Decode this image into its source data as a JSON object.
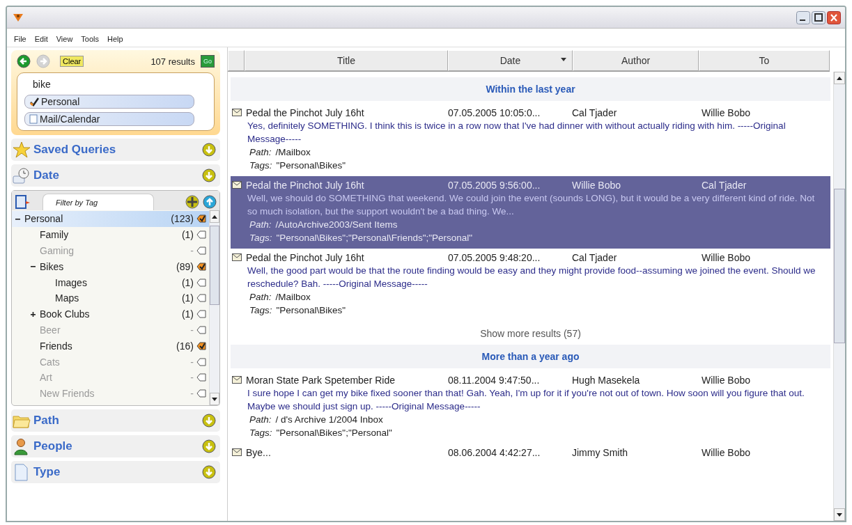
{
  "menu": [
    "File",
    "Edit",
    "View",
    "Tools",
    "Help"
  ],
  "search": {
    "back_disabled": false,
    "forward_disabled": true,
    "clear": "Clear",
    "results": "107 results",
    "go": "Go",
    "query": "bike",
    "scopes": [
      {
        "label": "Personal",
        "checked": true
      },
      {
        "label": "Mail/Calendar",
        "checked": false
      }
    ]
  },
  "sections_top": [
    {
      "label": "Saved Queries",
      "expanded": false
    },
    {
      "label": "Date",
      "expanded": false
    }
  ],
  "tag_panel": {
    "filter_placeholder": "Filter by Tag",
    "expanded": true,
    "tags": [
      {
        "name": "Personal",
        "count": "(123)",
        "checked": true,
        "disabled": false,
        "selected": true,
        "expanded": true,
        "children": [
          {
            "name": "Family",
            "count": "(1)",
            "checked": false,
            "disabled": false,
            "selected": false
          },
          {
            "name": "Gaming",
            "count": "-",
            "checked": false,
            "disabled": true,
            "selected": false
          },
          {
            "name": "Bikes",
            "count": "(89)",
            "checked": true,
            "disabled": false,
            "selected": false,
            "expanded": true,
            "children": [
              {
                "name": "Images",
                "count": "(1)",
                "checked": false,
                "disabled": false,
                "selected": false
              },
              {
                "name": "Maps",
                "count": "(1)",
                "checked": false,
                "disabled": false,
                "selected": false
              }
            ]
          },
          {
            "name": "Book Clubs",
            "count": "(1)",
            "checked": false,
            "disabled": false,
            "selected": false,
            "expanded": false
          },
          {
            "name": "Beer",
            "count": "-",
            "checked": false,
            "disabled": true,
            "selected": false
          },
          {
            "name": "Friends",
            "count": "(16)",
            "checked": true,
            "disabled": false,
            "selected": false
          },
          {
            "name": "Cats",
            "count": "-",
            "checked": false,
            "disabled": true,
            "selected": false
          },
          {
            "name": "Art",
            "count": "-",
            "checked": false,
            "disabled": true,
            "selected": false
          },
          {
            "name": "New Friends",
            "count": "-",
            "checked": false,
            "disabled": true,
            "selected": false
          }
        ]
      }
    ]
  },
  "sections_bottom": [
    {
      "label": "Path",
      "expanded": false
    },
    {
      "label": "People",
      "expanded": false
    },
    {
      "label": "Type",
      "expanded": false
    }
  ],
  "table": {
    "columns": [
      {
        "label": "Title",
        "sorted": false
      },
      {
        "label": "Date",
        "sorted": true
      },
      {
        "label": "Author",
        "sorted": false
      },
      {
        "label": "To",
        "sorted": false
      }
    ],
    "groups": [
      {
        "heading": "Within the last year",
        "more": "Show more results (57)",
        "rows": [
          {
            "title": "Pedal the Pinchot July 16ht",
            "date": "07.05.2005  10:05:0...",
            "author": "Cal Tjader",
            "to": "Willie Bobo",
            "selected": false,
            "body": "Yes, definitely SOMETHING.  I think this is twice in a row now that I've had dinner with            without actually riding with him.   -----Original  Message-----",
            "path_label": "Path:",
            "path": "/Mailbox",
            "tags_label": "Tags:",
            "tags": "\"Personal\\Bikes\""
          },
          {
            "title": "Pedal the Pinchot July 16ht",
            "date": "07.05.2005  9:56:00...",
            "author": "Willie Bobo",
            "to": "Cal Tjader",
            "selected": true,
            "body": "Well, we should do SOMETHING that weekend. We could join the event (sounds LONG), but it would be a very different kind of ride. Not so much isolation, but the support wouldn't be a bad thing.  We...",
            "path_label": "Path:",
            "path": "/AutoArchive2003/Sent Items",
            "tags_label": "Tags:",
            "tags": "\"Personal\\Bikes\";\"Personal\\Friends\";\"Personal\""
          },
          {
            "title": "Pedal the Pinchot July 16ht",
            "date": "07.05.2005  9:48:20...",
            "author": "Cal Tjader",
            "to": "Willie Bobo",
            "selected": false,
            "body": "Well, the good part would be that the route finding would be easy and they might provide food--assuming we joined the event.  Should we reschedule? Bah.  -----Original  Message-----",
            "path_label": "Path:",
            "path": "/Mailbox",
            "tags_label": "Tags:",
            "tags": "\"Personal\\Bikes\""
          }
        ]
      },
      {
        "heading": "More than a year ago",
        "rows": [
          {
            "title": "Moran State Park Spetember Ride",
            "date": "08.11.2004  9:47:50...",
            "author": "Hugh Masekela",
            "to": "Willie Bobo",
            "selected": false,
            "body": "I sure hope I can get my bike fixed sooner than that! Gah.  Yeah, I'm up for it if you're not out of town. How soon will you figure that out. Maybe we should just sign up.   -----Original  Message-----",
            "path_label": "Path:",
            "path": "/   d's Archive 1/2004 Inbox",
            "tags_label": "Tags:",
            "tags": "\"Personal\\Bikes\";\"Personal\""
          },
          {
            "title": "Bye...",
            "date": "08.06.2004  4:42:27...",
            "author": "Jimmy Smith",
            "to": "Willie Bobo",
            "selected": false
          }
        ]
      }
    ]
  }
}
